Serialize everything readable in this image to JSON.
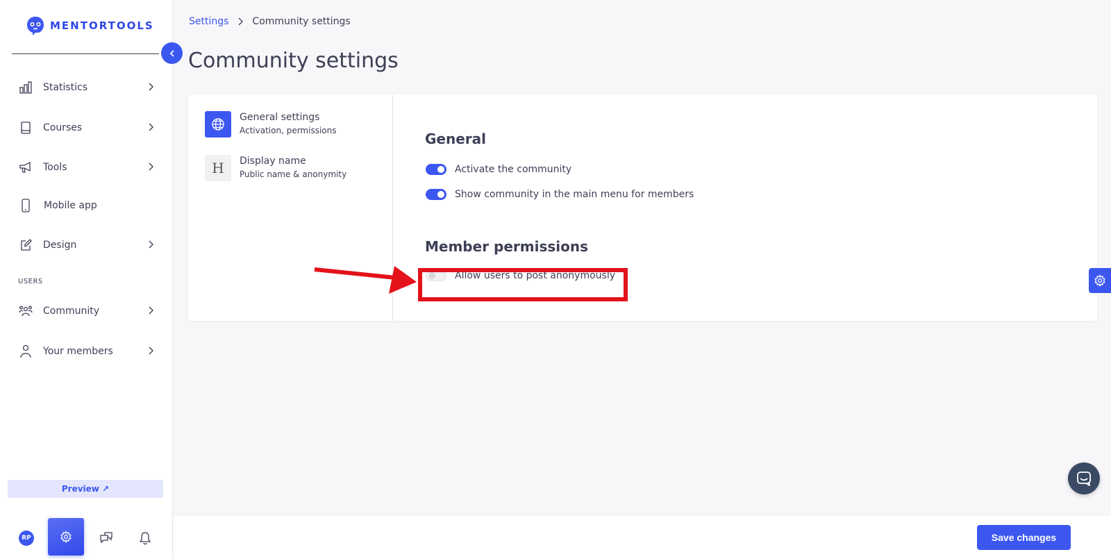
{
  "brand": {
    "name": "MENTORTOOLS"
  },
  "sidebar": {
    "items": [
      {
        "label": "Statistics",
        "icon": "bar-chart-icon",
        "has_chevron": true
      },
      {
        "label": "Courses",
        "icon": "book-icon",
        "has_chevron": true
      },
      {
        "label": "Tools",
        "icon": "megaphone-icon",
        "has_chevron": true
      },
      {
        "label": "Mobile app",
        "icon": "phone-icon",
        "has_chevron": false
      },
      {
        "label": "Design",
        "icon": "pencil-icon",
        "has_chevron": true
      }
    ],
    "section_label": "USERS",
    "user_items": [
      {
        "label": "Community",
        "icon": "people-icon",
        "has_chevron": true
      },
      {
        "label": "Your members",
        "icon": "user-icon",
        "has_chevron": true
      }
    ],
    "preview_label": "Preview ↗",
    "avatar_initials": "RP"
  },
  "breadcrumb": {
    "parent": "Settings",
    "current": "Community settings"
  },
  "page_title": "Community settings",
  "settings_tabs": [
    {
      "title": "General settings",
      "subtitle": "Activation, permissions",
      "icon": "globe-icon",
      "active": true
    },
    {
      "title": "Display name",
      "subtitle": "Public name & anonymity",
      "icon": "heading-icon",
      "icon_glyph": "H",
      "active": false
    }
  ],
  "general": {
    "title": "General",
    "toggles": [
      {
        "label": "Activate the community",
        "on": true
      },
      {
        "label": "Show community in the main menu for members",
        "on": true
      }
    ]
  },
  "permissions": {
    "title": "Member permissions",
    "toggles": [
      {
        "label": "Allow users to post anonymously",
        "on": false
      }
    ]
  },
  "footer": {
    "save_label": "Save changes"
  },
  "colors": {
    "accent": "#3c57f0",
    "annotation": "#e3121b",
    "text": "#3d3f55"
  }
}
